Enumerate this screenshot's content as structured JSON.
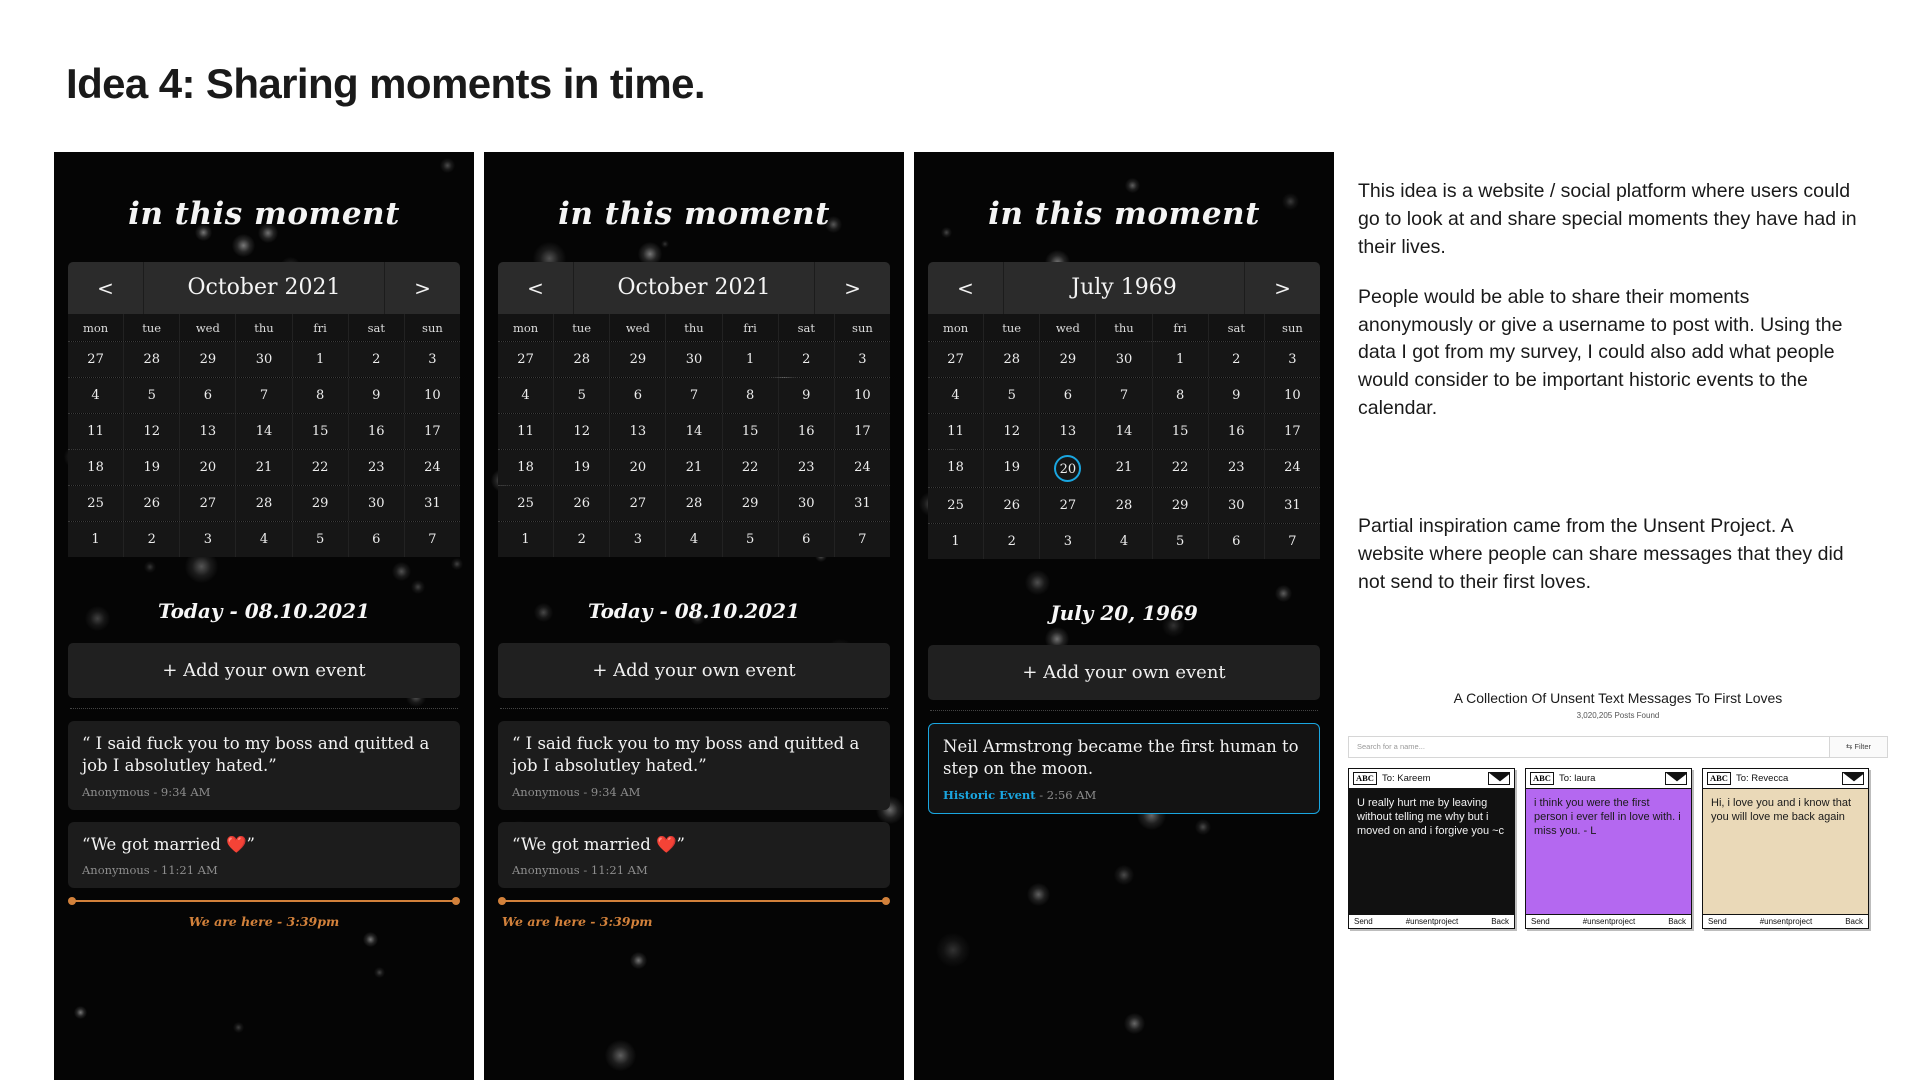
{
  "slide": {
    "title": "Idea 4: Sharing moments in time."
  },
  "colors": {
    "accent_orange": "#d2813b",
    "accent_blue": "#1aa6e0",
    "phone_bg": "#050505",
    "card_bg": "#1c1c1c"
  },
  "phones": [
    {
      "brand": "in this moment",
      "prev_label": "<",
      "next_label": ">",
      "month_label": "October 2021",
      "dows": [
        "mon",
        "tue",
        "wed",
        "thu",
        "fri",
        "sat",
        "sun"
      ],
      "weeks": [
        [
          "27",
          "28",
          "29",
          "30",
          "1",
          "2",
          "3"
        ],
        [
          "4",
          "5",
          "6",
          "7",
          "8",
          "9",
          "10"
        ],
        [
          "11",
          "12",
          "13",
          "14",
          "15",
          "16",
          "17"
        ],
        [
          "18",
          "19",
          "20",
          "21",
          "22",
          "23",
          "24"
        ],
        [
          "25",
          "26",
          "27",
          "28",
          "29",
          "30",
          "31"
        ],
        [
          "1",
          "2",
          "3",
          "4",
          "5",
          "6",
          "7"
        ]
      ],
      "selected": null,
      "today_label": "Today - 08.10.2021",
      "add_event_label": "+ Add your own event",
      "posts": [
        {
          "text": "“ I said fuck you to my boss and quitted a job I absolutley hated.”",
          "tag": "",
          "meta": "Anonymous - 9:34 AM",
          "historic": false
        },
        {
          "text": "“We got married ❤️”",
          "tag": "",
          "meta": "Anonymous - 11:21 AM",
          "historic": false
        }
      ],
      "now_label": "We are here - 3:39pm",
      "now_align": "center",
      "show_now": true
    },
    {
      "brand": "in this moment",
      "prev_label": "<",
      "next_label": ">",
      "month_label": "October 2021",
      "dows": [
        "mon",
        "tue",
        "wed",
        "thu",
        "fri",
        "sat",
        "sun"
      ],
      "weeks": [
        [
          "27",
          "28",
          "29",
          "30",
          "1",
          "2",
          "3"
        ],
        [
          "4",
          "5",
          "6",
          "7",
          "8",
          "9",
          "10"
        ],
        [
          "11",
          "12",
          "13",
          "14",
          "15",
          "16",
          "17"
        ],
        [
          "18",
          "19",
          "20",
          "21",
          "22",
          "23",
          "24"
        ],
        [
          "25",
          "26",
          "27",
          "28",
          "29",
          "30",
          "31"
        ],
        [
          "1",
          "2",
          "3",
          "4",
          "5",
          "6",
          "7"
        ]
      ],
      "selected": null,
      "today_label": "Today - 08.10.2021",
      "add_event_label": "+ Add your own event",
      "posts": [
        {
          "text": "“ I said fuck you to my boss and quitted a job I absolutley hated.”",
          "tag": "",
          "meta": "Anonymous - 9:34 AM",
          "historic": false
        },
        {
          "text": "“We got married ❤️”",
          "tag": "",
          "meta": "Anonymous - 11:21 AM",
          "historic": false
        }
      ],
      "now_label": "We are here - 3:39pm",
      "now_align": "left",
      "show_now": true
    },
    {
      "brand": "in this moment",
      "prev_label": "<",
      "next_label": ">",
      "month_label": "July 1969",
      "dows": [
        "mon",
        "tue",
        "wed",
        "thu",
        "fri",
        "sat",
        "sun"
      ],
      "weeks": [
        [
          "27",
          "28",
          "29",
          "30",
          "1",
          "2",
          "3"
        ],
        [
          "4",
          "5",
          "6",
          "7",
          "8",
          "9",
          "10"
        ],
        [
          "11",
          "12",
          "13",
          "14",
          "15",
          "16",
          "17"
        ],
        [
          "18",
          "19",
          "20",
          "21",
          "22",
          "23",
          "24"
        ],
        [
          "25",
          "26",
          "27",
          "28",
          "29",
          "30",
          "31"
        ],
        [
          "1",
          "2",
          "3",
          "4",
          "5",
          "6",
          "7"
        ]
      ],
      "selected": {
        "week": 3,
        "day": 2,
        "value": "20"
      },
      "today_label": "July 20, 1969",
      "add_event_label": "+ Add your own event",
      "posts": [
        {
          "text": "Neil Armstrong became the first human to step on the moon.",
          "tag": "Historic Event",
          "meta": " - 2:56 AM",
          "historic": true
        }
      ],
      "now_label": "",
      "now_align": "center",
      "show_now": false
    }
  ],
  "notes": [
    "This idea is a website / social platform where users could go to look at and share special moments they have had in their lives.",
    "People would be able to share their moments anonymously or give a username to post with. Using the data I got from my survey, I could also add what people would consider to be important historic events to the calendar.",
    "Partial inspiration came from the Unsent Project. A website where people can share messages that they did not send to their first loves."
  ],
  "unsent": {
    "title": "A Collection Of Unsent Text Messages To First Loves",
    "count": "3,020,205 Posts Found",
    "search_placeholder": "Search for a name...",
    "filter_label": "Filter",
    "cards": [
      {
        "badge": "ABC",
        "to": "To: Kareem",
        "body": "U really hurt me by leaving without telling me why but i moved on and i forgive you ~c",
        "theme": "dark",
        "send": "Send",
        "hashtag": "#unsentproject",
        "back": "Back"
      },
      {
        "badge": "ABC",
        "to": "To: laura",
        "body": "i think you were the first person i ever fell in love with. i miss you. - L",
        "theme": "purple",
        "send": "Send",
        "hashtag": "#unsentproject",
        "back": "Back"
      },
      {
        "badge": "ABC",
        "to": "To: Revecca",
        "body": "Hi, i love you and i know that you will love me back again",
        "theme": "cream",
        "send": "Send",
        "hashtag": "#unsentproject",
        "back": "Back"
      }
    ]
  }
}
